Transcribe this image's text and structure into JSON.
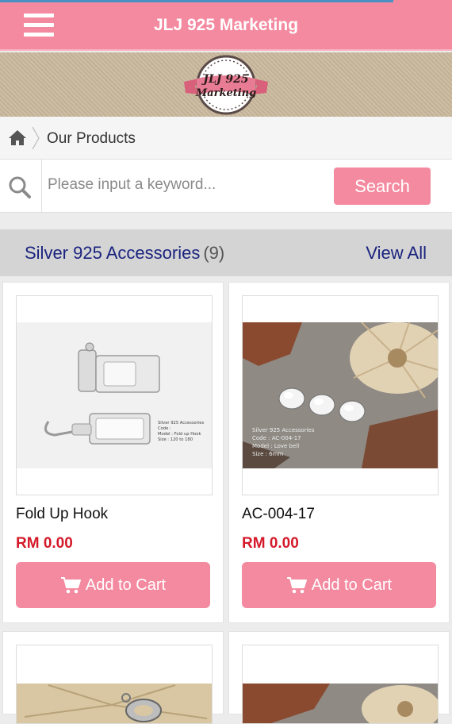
{
  "header": {
    "title": "JLJ 925 Marketing",
    "menu_icon": "hamburger-menu-icon"
  },
  "banner": {
    "logo_line1": "JLJ 925",
    "logo_line2": "Marketing"
  },
  "breadcrumb": {
    "home_icon": "home-icon",
    "label": "Our Products"
  },
  "search": {
    "placeholder": "Please input a keyword...",
    "value": "",
    "button_label": "Search"
  },
  "section": {
    "title": "Silver 925 Accessories",
    "count": "(9)",
    "view_all": "View All"
  },
  "products": [
    {
      "name": "Fold Up Hook",
      "price": "RM 0.00",
      "cart_label": "Add to Cart",
      "caption": [
        "Silver 925 Accessories",
        "Code :",
        "Model : Fold up Hook",
        "Size : 120 to 180"
      ]
    },
    {
      "name": "AC-004-17",
      "price": "RM 0.00",
      "cart_label": "Add to Cart",
      "caption": [
        "Silver 925 Accessories",
        "Code : AC-004-17",
        "Model : Love bell",
        "Size : 6mm"
      ]
    }
  ],
  "colors": {
    "accent": "#f48aa0",
    "section_text": "#1a237e",
    "price": "#d41a2a"
  }
}
